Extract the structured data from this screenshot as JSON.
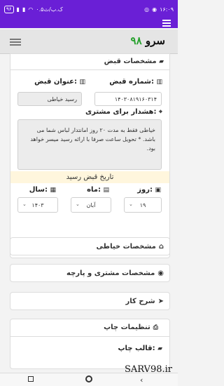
{
  "status": {
    "time": "۱۶:۰۹",
    "network": "۰.۵ک.ب/ث",
    "battery": "۹۶"
  },
  "app": {
    "logo_number": "۹۸",
    "logo_text": "سرو"
  },
  "receipt": {
    "header": "مشخصات قبض",
    "number_label": "شماره قبض:",
    "number_value": "۱۴۰۳۰۸۱۹۱۶۰۳۱۴",
    "title_label": "عنوان قبض:",
    "title_value": "رسید خیاطی",
    "warning_label": "هشدار برای مشتری:",
    "warning_text": "خیاطی فقط به مدت ۲۰ روز امانتدار لباس شما می باشد. * تحویل ساعت صرفا با ارائه رسید میسر خواهد بود.",
    "date_bar": "تاریخ قبض رسید",
    "day_label": "روز:",
    "month_label": "ماه:",
    "year_label": "سال:",
    "day_value": "۱۹",
    "month_value": "آبان",
    "year_value": "۱۴۰۳"
  },
  "sections": {
    "tailor": "مشخصات خیاطی",
    "customer": "مشخصات مشتری و پارچه",
    "job": "شرح کار",
    "print": "تنظیمات چاپ",
    "print_template_label": "قالب چاپ:"
  },
  "watermark": "SARV98.ir"
}
